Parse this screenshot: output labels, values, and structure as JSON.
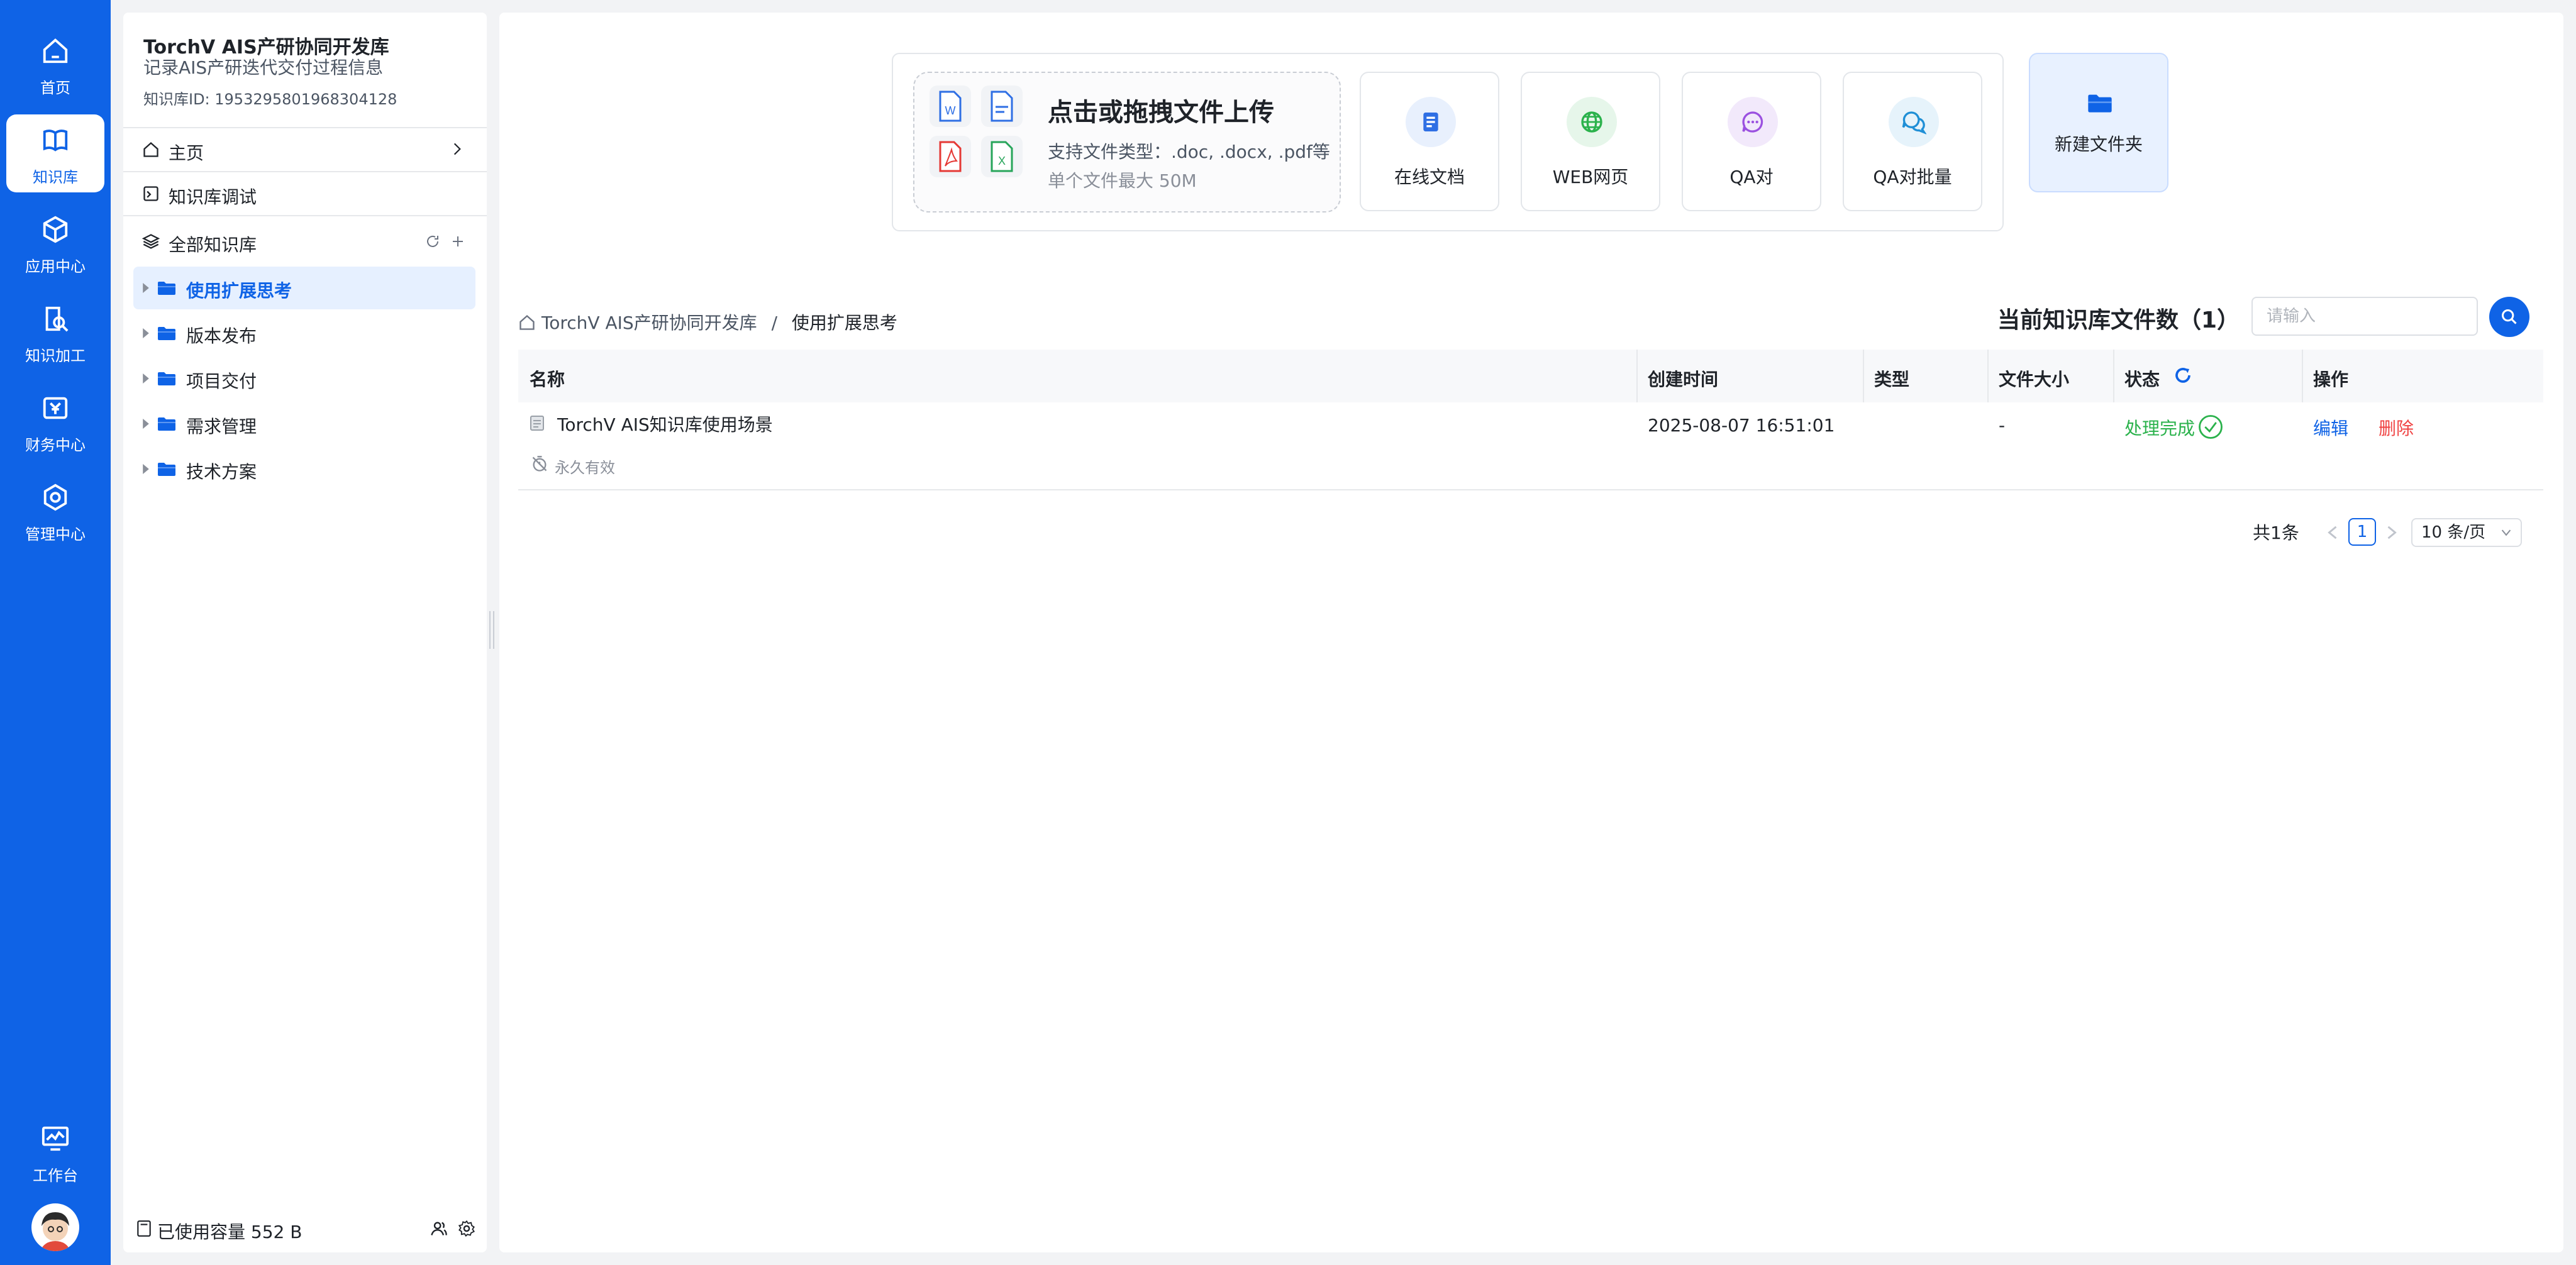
{
  "rail": {
    "items": [
      {
        "label": "首页",
        "icon": "home-icon"
      },
      {
        "label": "知识库",
        "icon": "book-icon",
        "active": true
      },
      {
        "label": "应用中心",
        "icon": "cube-icon"
      },
      {
        "label": "知识加工",
        "icon": "edit-doc-icon"
      },
      {
        "label": "财务中心",
        "icon": "finance-icon"
      },
      {
        "label": "管理中心",
        "icon": "gear-hex-icon"
      }
    ],
    "workbench_label": "工作台"
  },
  "sidebar": {
    "kb_title": "TorchV AIS产研协同开发库",
    "kb_desc": "记录AIS产研迭代交付过程信息",
    "kb_id": "知识库ID: 1953295801968304128",
    "home_label": "主页",
    "debug_label": "知识库调试",
    "all_label": "全部知识库",
    "folders": [
      {
        "label": "使用扩展思考",
        "active": true
      },
      {
        "label": "版本发布"
      },
      {
        "label": "项目交付"
      },
      {
        "label": "需求管理"
      },
      {
        "label": "技术方案"
      }
    ],
    "usage": "已使用容量 552 B"
  },
  "upload": {
    "title": "点击或拖拽文件上传",
    "types": "支持文件类型：.doc, .docx, .pdf等",
    "limit": "单个文件最大 50M",
    "tiles": [
      {
        "label": "在线文档",
        "icon": "doc-icon",
        "color": "#2f6fe4"
      },
      {
        "label": "WEB网页",
        "icon": "globe-icon",
        "color": "#2bb24c"
      },
      {
        "label": "QA对",
        "icon": "chat-icon",
        "color": "#9b51e0"
      },
      {
        "label": "QA对批量",
        "icon": "chat-bulk-icon",
        "color": "#1f8fd6"
      }
    ],
    "new_folder": "新建文件夹"
  },
  "breadcrumb": {
    "root": "TorchV AIS产研协同开发库",
    "sep": "/",
    "current": "使用扩展思考"
  },
  "file_count": "当前知识库文件数（1）",
  "search": {
    "placeholder": "请输入"
  },
  "table": {
    "headers": [
      "名称",
      "创建时间",
      "类型",
      "文件大小",
      "状态",
      "操作"
    ],
    "rows": [
      {
        "name": "TorchV AIS知识库使用场景",
        "validity": "永久有效",
        "created": "2025-08-07 16:51:01",
        "type": "",
        "size": "-",
        "status": "处理完成",
        "edit": "编辑",
        "delete": "删除"
      }
    ]
  },
  "pagination": {
    "total": "共1条",
    "current": "1",
    "page_size": "10 条/页"
  },
  "colors": {
    "brand": "#0f63e6",
    "success": "#2bb24c",
    "danger": "#f04444"
  }
}
